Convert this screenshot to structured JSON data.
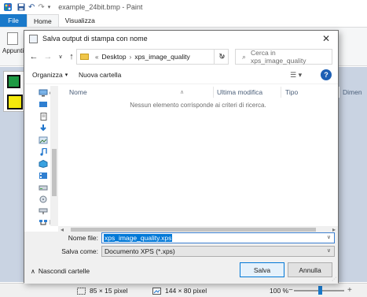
{
  "paint": {
    "title": "example_24bit.bmp - Paint",
    "tabs": {
      "file": "File",
      "home": "Home",
      "view": "Visualizza"
    },
    "ribbon": {
      "clipboard_label": "Appunti"
    },
    "status": {
      "selection_size": "85 × 15 pixel",
      "image_size": "144 × 80 pixel",
      "zoom": "100 %"
    }
  },
  "dialog": {
    "title": "Salva output di stampa con nome",
    "breadcrumb": [
      "Desktop",
      "xps_image_quality"
    ],
    "search_placeholder": "Cerca in xps_image_quality",
    "toolbar": {
      "organize": "Organizza",
      "new_folder": "Nuova cartella"
    },
    "nav_pane_partial_labels": [
      "C",
      "R"
    ],
    "columns": [
      "Nome",
      "Ultima modifica",
      "Tipo",
      "Dimen"
    ],
    "empty_message": "Nessun elemento corrisponde ai criteri di ricerca.",
    "filename_label": "Nome file:",
    "filename_value": "xps_image_quality.xps",
    "save_type_label": "Salva come:",
    "save_type_value": "Documento XPS (*.xps)",
    "hide_folders": "Nascondi cartelle",
    "save_button": "Salva",
    "cancel_button": "Annulla"
  },
  "colors": {
    "accent": "#0078d7",
    "file_tab": "#1979ca",
    "canvas_bg": "#c9d3e2",
    "swatch_green": "#1e9a43",
    "swatch_yellow": "#f4e90c"
  },
  "icons": [
    "paint-app-icon",
    "save-icon",
    "undo-icon",
    "redo-icon",
    "dropdown-icon",
    "back-arrow-icon",
    "forward-arrow-icon",
    "recent-dropdown-icon",
    "up-arrow-icon",
    "folder-icon",
    "refresh-icon",
    "search-icon",
    "view-options-icon",
    "help-icon",
    "close-icon",
    "chevron-up-icon",
    "selection-icon",
    "image-size-icon",
    "zoom-minus-icon",
    "zoom-plus-icon"
  ]
}
